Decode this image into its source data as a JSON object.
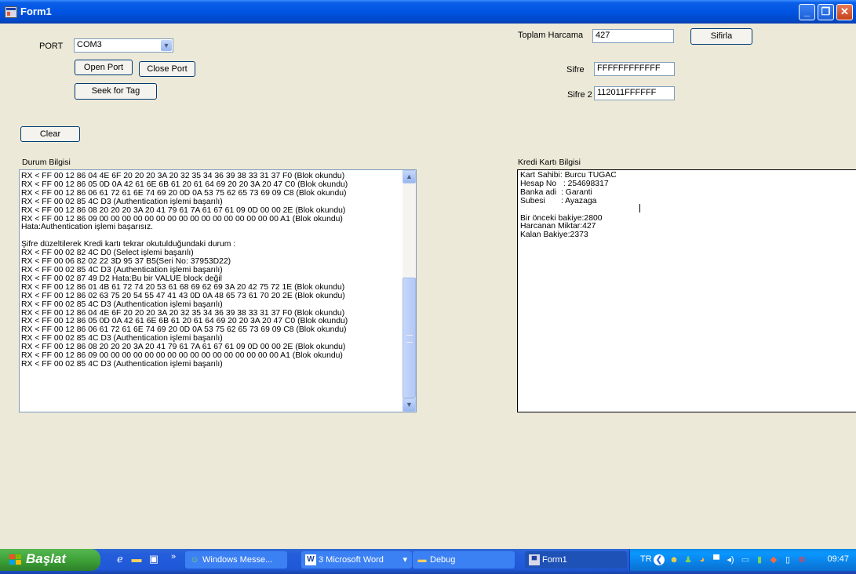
{
  "window": {
    "title": "Form1",
    "minimize": "_",
    "restore": "❐",
    "close": "✕"
  },
  "form": {
    "port_label": "PORT",
    "port_value": "COM3",
    "open_port": "Open Port",
    "close_port": "Close Port",
    "seek_for_tag": "Seek for Tag",
    "clear": "Clear",
    "toplam_harcama_label": "Toplam Harcama",
    "toplam_harcama_value": "427",
    "sifirla": "Sifirla",
    "sifre_label": "Sifre",
    "sifre_value": "FFFFFFFFFFFF",
    "sifre2_label": "Sifre 2",
    "sifre2_value": "112011FFFFFF",
    "durum_label": "Durum Bilgisi",
    "kredi_label": "Kredi Kartı Bilgisi"
  },
  "durum_lines": [
    "RX < FF 00 12 86 04 4E 6F 20 20 20 3A 20 32 35 34 36 39 38 33 31 37 F0 (Blok okundu)",
    "RX < FF 00 12 86 05 0D 0A 42 61 6E 6B 61 20 61 64 69 20 20 3A 20 47 C0 (Blok okundu)",
    "RX < FF 00 12 86 06 61 72 61 6E 74 69 20 0D 0A 53 75 62 65 73 69 09 C8 (Blok okundu)",
    "RX < FF 00 02 85 4C D3 (Authentication işlemi başarılı)",
    "RX < FF 00 12 86 08 20 20 20 3A 20 41 79 61 7A 61 67 61 09 0D 00 00 2E (Blok okundu)",
    "RX < FF 00 12 86 09 00 00 00 00 00 00 00 00 00 00 00 00 00 00 00 00 A1 (Blok okundu)",
    "Hata:Authentication işlemi başarısız.",
    "",
    "Şifre düzeltilerek Kredi kartı tekrar okutulduğundaki durum :",
    "RX < FF 00 02 82 4C D0 (Select işlemi başarılı)",
    "RX < FF 00 06 82 02 22 3D 95 37 B5(Seri No: 37953D22)",
    "RX < FF 00 02 85 4C D3 (Authentication işlemi başarılı)",
    "RX < FF 00 02 87 49 D2 Hata:Bu bir VALUE block değil",
    "RX < FF 00 12 86 01 4B 61 72 74 20 53 61 68 69 62 69 3A 20 42 75 72 1E (Blok okundu)",
    "RX < FF 00 12 86 02 63 75 20 54 55 47 41 43 0D 0A 48 65 73 61 70 20 2E (Blok okundu)",
    "RX < FF 00 02 85 4C D3 (Authentication işlemi başarılı)",
    "RX < FF 00 12 86 04 4E 6F 20 20 20 3A 20 32 35 34 36 39 38 33 31 37 F0 (Blok okundu)",
    "RX < FF 00 12 86 05 0D 0A 42 61 6E 6B 61 20 61 64 69 20 20 3A 20 47 C0 (Blok okundu)",
    "RX < FF 00 12 86 06 61 72 61 6E 74 69 20 0D 0A 53 75 62 65 73 69 09 C8 (Blok okundu)",
    "RX < FF 00 02 85 4C D3 (Authentication işlemi başarılı)",
    "RX < FF 00 12 86 08 20 20 20 3A 20 41 79 61 7A 61 67 61 09 0D 00 00 2E (Blok okundu)",
    "RX < FF 00 12 86 09 00 00 00 00 00 00 00 00 00 00 00 00 00 00 00 00 A1 (Blok okundu)",
    "RX < FF 00 02 85 4C D3 (Authentication işlemi başarılı)"
  ],
  "kredi_lines": [
    "Kart Sahibi: Burcu TUGAC",
    "Hesap No   : 254698317",
    "Banka adi  : Garanti",
    "Subesi       : Ayazaga",
    "",
    "Bir önceki bakiye:2800",
    "Harcanan Miktar:427",
    "Kalan Bakiye:2373"
  ],
  "taskbar": {
    "start": "Başlat",
    "chevron": "»",
    "tasks": [
      {
        "label": "Windows Messe...",
        "icon": "messenger-icon"
      },
      {
        "label": "3 Microsoft Word",
        "icon": "word-icon"
      },
      {
        "label": "Debug",
        "icon": "folder-icon"
      },
      {
        "label": "Form1",
        "icon": "form-icon"
      }
    ],
    "lang": "TR",
    "time": "09:47"
  }
}
